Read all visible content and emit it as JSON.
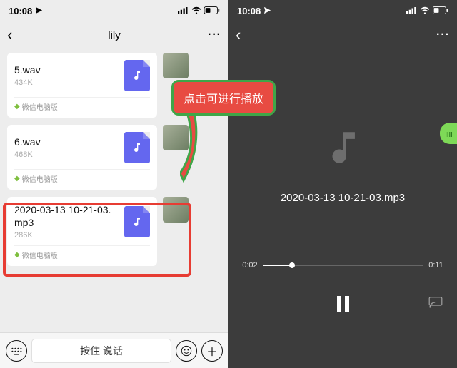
{
  "left": {
    "statusTime": "10:08",
    "headerTitle": "lily",
    "files": [
      {
        "name": "5.wav",
        "size": "434K",
        "source": "微信电脑版"
      },
      {
        "name": "6.wav",
        "size": "468K",
        "source": "微信电脑版"
      },
      {
        "name": "2020-03-13 10-21-03.mp3",
        "size": "286K",
        "source": "微信电脑版"
      }
    ],
    "talkLabel": "按住 说话"
  },
  "right": {
    "statusTime": "10:08",
    "filename": "2020-03-13 10-21-03.mp3",
    "elapsed": "0:02",
    "duration": "0:11",
    "progressPercent": 18
  },
  "callout": "点击可进行播放"
}
